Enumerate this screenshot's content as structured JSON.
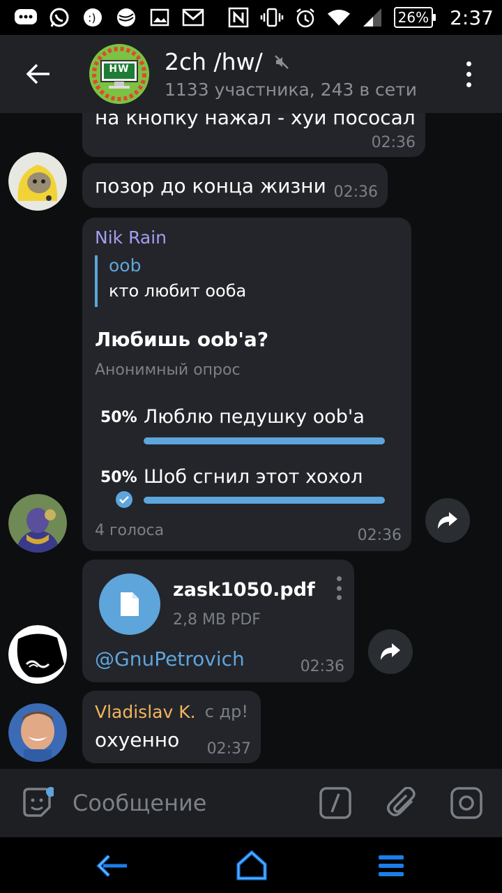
{
  "status_bar": {
    "battery": "26%",
    "time": "2:37"
  },
  "header": {
    "title": "2ch /hw/",
    "subtitle": "1133 участника, 243 в сети",
    "avatar_text": "HW"
  },
  "messages": {
    "m1": {
      "text": "на кнопку нажал - хуи пососал",
      "time": "02:36"
    },
    "m2": {
      "text": "позор до конца жизни",
      "time": "02:36"
    },
    "poll": {
      "sender": "Nik Rain",
      "reply_name": "oob",
      "reply_text": "кто любит ооба",
      "question": "Любишь oob'a?",
      "poll_type": "Анонимный опрос",
      "options": [
        {
          "percent_label": "50%",
          "text": "Люблю педушку oob'a",
          "fraction": 0.5
        },
        {
          "percent_label": "50%",
          "text": "Шоб сгнил этот хохол",
          "fraction": 0.5
        }
      ],
      "votes": "4 голоса",
      "time": "02:36"
    },
    "file": {
      "name": "zask1050.pdf",
      "meta": "2,8 MB PDF",
      "caption": "@GnuPetrovich",
      "time": "02:36"
    },
    "m5": {
      "sender": "Vladislav K.",
      "reply_snippet": "с др!",
      "text": "охуенно",
      "time": "02:37"
    }
  },
  "input": {
    "placeholder": "Сообщение"
  },
  "colors": {
    "accent": "#5ea5dc",
    "sender_purple": "#a39ef0",
    "sender_orange": "#f2b55d",
    "bubble": "#23252a"
  }
}
